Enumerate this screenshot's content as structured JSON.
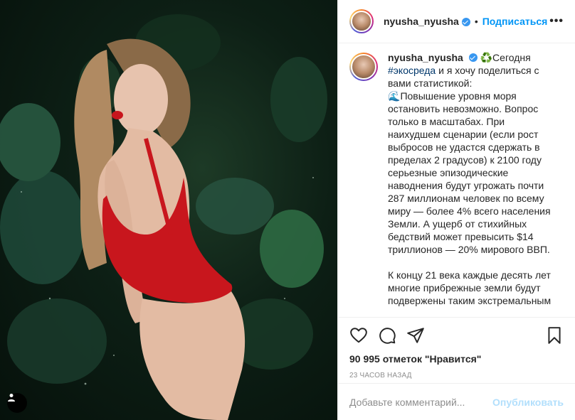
{
  "photo": {
    "description_icon": "person-tag-icon"
  },
  "header": {
    "username": "nyusha_nyusha",
    "separator": "•",
    "follow_label": "Подписаться",
    "more_label": "•••"
  },
  "caption": {
    "username": "nyusha_nyusha",
    "emoji_recycle": "♻️",
    "intro": "Сегодня",
    "hashtag": "#экосреда",
    "intro_rest": " и я хочу поделиться с вами статистикой:",
    "emoji_wave": "🌊",
    "para1": "Повышение уровня моря остановить невозможно. Вопрос только в масштабах. При наихудшем сценарии (если рост выбросов не удастся сдержать в пределах 2 градусов) к 2100 году серьезные эпизодические наводнения будут угрожать почти 287 миллионам человек по всему миру — более 4% всего населения Земли. А ущерб от стихийных бедствий может превысить $14 триллионов — 20% мирового ВВП.",
    "para2": "К концу 21 века каждые десять лет многие прибрежные земли будут подвержены таким экстремальным"
  },
  "actions": {
    "likes": "90 995 отметок \"Нравится\"",
    "time": "23 часов назад"
  },
  "comment": {
    "placeholder": "Добавьте комментарий...",
    "post_label": "Опубликовать"
  },
  "colors": {
    "link_blue": "#0095f6",
    "post_disabled": "#b2dffc",
    "swimsuit_red": "#c8161d"
  }
}
